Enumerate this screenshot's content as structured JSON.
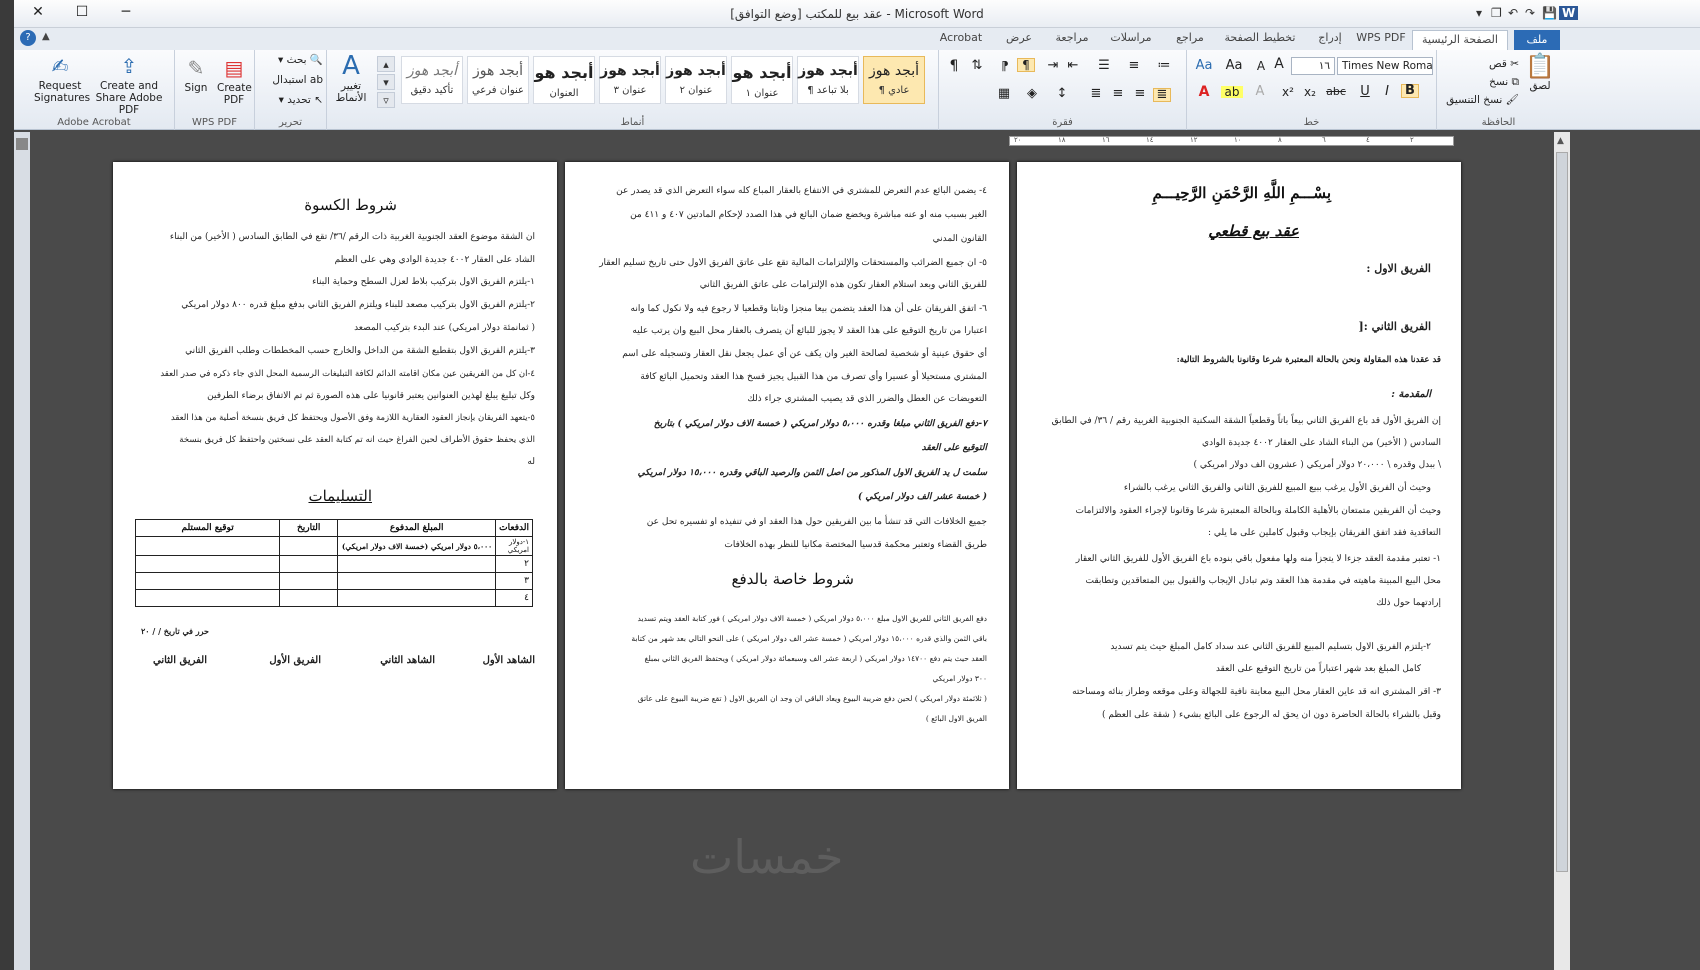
{
  "window": {
    "title": "عقد بيع للمكتب [وضع التوافق] - Microsoft Word",
    "close": "✕",
    "maximize": "☐",
    "minimize": "─",
    "qat": [
      "▾",
      "❐",
      "↶",
      "↷",
      "💾",
      "W"
    ]
  },
  "tabs": [
    {
      "label": "ملف",
      "kind": "file"
    },
    {
      "label": "الصفحة الرئيسية",
      "kind": "selected"
    },
    {
      "label": "WPS PDF",
      "kind": "normal"
    },
    {
      "label": "إدراج",
      "kind": "normal"
    },
    {
      "label": "تخطيط الصفحة",
      "kind": "normal"
    },
    {
      "label": "مراجع",
      "kind": "normal"
    },
    {
      "label": "مراسلات",
      "kind": "normal"
    },
    {
      "label": "مراجعة",
      "kind": "normal"
    },
    {
      "label": "عرض",
      "kind": "normal"
    },
    {
      "label": "Acrobat",
      "kind": "normal"
    }
  ],
  "ribbon": {
    "acrobat": {
      "group": "Adobe Acrobat",
      "request": "Request Signatures",
      "create_share": "Create and Share Adobe PDF"
    },
    "wps": {
      "group": "WPS PDF",
      "sign": "Sign",
      "create": "Create PDF"
    },
    "editing": {
      "group": "تحرير",
      "find": "بحث",
      "replace": "استبدال",
      "select": "تحديد"
    },
    "change_styles": "تغيير الأنماط",
    "styles": {
      "group": "أنماط",
      "items": [
        {
          "preview": "أبجد هوز",
          "label": "¶ عادي"
        },
        {
          "preview": "أبجد هوز",
          "label": "¶ بلا تباعد"
        },
        {
          "preview": "أبجد هو",
          "label": "عنوان ١"
        },
        {
          "preview": "أبجد هوز",
          "label": "عنوان ٢"
        },
        {
          "preview": "أبجد هوز",
          "label": "عنوان ٣"
        },
        {
          "preview": "أبجد هو",
          "label": "العنوان"
        },
        {
          "preview": "أبجد هوز",
          "label": "عنوان فرعي"
        },
        {
          "preview": "أبجد هوز",
          "label": "تأكيد دقيق"
        }
      ]
    },
    "paragraph": {
      "group": "فقرة"
    },
    "font": {
      "group": "خط",
      "name": "Times New Roma",
      "size": "١٦"
    },
    "clipboard": {
      "group": "الحافظة",
      "paste": "لصق",
      "cut": "قص",
      "copy": "نسخ",
      "format_painter": "نسخ التنسيق"
    }
  },
  "ruler": {
    "ticks": [
      "٢٠",
      "١٨",
      "١٦",
      "١٤",
      "١٢",
      "١٠",
      "٨",
      "٦",
      "٤",
      "٢"
    ]
  },
  "page1": {
    "bismillah": "بِسْـــمِ اللَّهِ الرَّحْمَنِ الرَّحِيـــمِ",
    "title": "عقد بيع قطعي",
    "party1": "الفريق الاول :",
    "party2": "الفريق الثاني :[",
    "intro": "قد عقدنا هذه المقاولة ونحن بالحالة المعتبرة شرعا وقانونا بالشروط التالية:",
    "preamble_title": "المقدمة :",
    "lines": [
      "إن الفريق الأول قد باع الفريق الثاني بيعاً باتاً وقطعياً الشقة السكنية الجنوبية الغربية رقم / ٣٦/ في الطابق",
      "السادس ( الأخير) من البناء الشاد على العقار ٤٠٠٢ جديدة الوادي",
      "\\ ببدل وقدره \\ ٢٠،٠٠٠ دولار أمريكي ( عشرون الف دولار امريكي )",
      "وحيث أن الفريق الأول يرغب ببيع المبيع  للفريق الثاني والفريق الثاني يرغب بالشراء",
      "وحيث أن الفريقين متمتعان بالأهلية الكاملة وبالحالة المعتبرة شرعا وقانونا لإجراء العقود والالتزامات",
      "التعاقدية فقد اتفق الفريقان بإيجاب وقبول كاملين على ما يلي :",
      "١-   تعتبر مقدمة العقد جزءا لا يتجزأ منه ولها مفعول باقي بنوده باع الفريق الأول للفريق الثاني العقار",
      "محل البيع المبينة ماهيته في مقدمة هذا العقد وتم تبادل الإيجاب والقبول بين المتعاقدين وتطابقت",
      "إرادتهما حول ذلك",
      "٢-يلتزم الفريق الاول  بتسليم المبيع للفريق الثاني عند سداد كامل المبلغ حيث يتم تسديد",
      "كامل المبلغ بعد شهر اعتباراً من تاريخ التوقيع على العقد",
      "٣- اقر المشتري انه قد عاين العقار محل البيع معاينة نافية للجهالة وعلى موقعه وطراز بنائه ومساحته",
      "وقبل بالشراء بالحالة الحاضرة دون ان يحق له الرجوع على البائع بشيء ( شقة على العظم )"
    ]
  },
  "page2": {
    "lines": [
      "٤- يضمن البائع عدم التعرض للمشتري في الانتفاع بالعقار المباع كله سواء التعرض الذي قد يصدر عن",
      "الغير بسبب منه او عنه مباشرة ويخضع ضمان البائع في هذا الصدد لإحكام المادتين ٤٠٧ و ٤١١ من",
      "القانون المدني",
      "٥- ان جميع الضرائب والمستحقات والإلتزامات المالية تقع على عاتق الفريق الاول حتى تاريخ تسليم العقار",
      "للفريق الثاني وبعد استلام العقار تكون هذه الإلتزامات على عاتق الفريق الثاني",
      "٦- اتفق الفريقان على أن هذا العقد يتضمن بيعا منجزا وثابتا وقطعيا لا رجوع فيه ولا نكول كما وانه",
      "اعتبارا من تاريخ التوقيع على هذا العقد لا يجوز للبائع أن يتصرف بالعقار محل البيع وان يرتب عليه",
      "أي حقوق عينية أو شخصية لصالحة الغير وان يكف عن أي عمل يجعل نقل العقار وتسجيله على اسم",
      "المشتري مستحيلا أو عسيرا وأي تصرف من هذا القبيل يجيز فسخ هذا العقد وتحميل البائع كافة",
      "التعويضات عن العطل والضرر الذي قد يصيب المشتري جراء ذلك",
      "٧-دفع الفريق الثاني مبلغا وقدره ٥،٠٠٠ دولار امريكي ( خمسة الاف دولار امريكي ) بتاريخ",
      "التوقيع على العقد",
      "سلمت ل يد الفريق الاول المذكور من اصل الثمن والرصيد الباقي وقدره ١٥،٠٠٠ دولار امريكي",
      "( خمسة عشر الف دولار امريكي )",
      "جميع الخلافات التي قد تنشأ ما بين الفريقين حول هذا العقد او في تنفيذه او تفسيره تحل عن",
      "طريق القضاء وتعتبر محكمة قدسيا المختصة مكانيا للنظر بهذه الخلافات"
    ],
    "pay_title": "شروط خاصة بالدفع",
    "pay_lines": [
      "دفع الفريق الثاني للفريق الاول مبلغ ٥،٠٠٠ دولار امريكي ( خمسة الاف دولار امريكي ) فور كتابة العقد ويتم تسديد",
      "باقي الثمن والذي قدره ١٥،٠٠٠ دولار امريكي ( خمسة عشر الف دولار امريكي ) على النحو التالي بعد شهر من كتابة",
      "العقد حيث يتم دفع ١٤٧٠٠ دولار امريكي ( اربعة عشر الف وسبعمائة دولار امريكي )  ويحتفظ الفريق الثاني بمبلغ",
      "٣٠٠ دولار امريكي",
      "( ثلاثمئة دولار امريكي ) لحين دفع ضريبة البيوع ويعاد الباقي ان وجد ان الفريق الاول ( تقع ضريبة البيوع على عاتق",
      "الفريق الاول البائع )"
    ]
  },
  "page3": {
    "title": "شروط الكسوة",
    "lines": [
      "ان الشقة موضوع العقد الجنوبية الغربية ذات الرقم /٣٦/  تقع في الطابق السادس ( الأخير) من البناء",
      "الشاد على العقار ٤٠٠٢ جديدة الوادي وهي على العظم",
      "١-يلتزم الفريق الاول بتركيب بلاط لعزل السطح وحماية البناء",
      "٢-يلتزم الفريق الاول بتركيب مصعد للبناء ويلتزم الفريق الثاني بدفع مبلغ قدره ٨٠٠ دولار امريكي",
      "( ثمانمئة دولار امريكي) عند البدء بتركيب المصعد",
      "٣-يلتزم الفريق الاول بتقطيع الشقة من الداخل والخارج حسب المخططات وطلب الفريق الثاني",
      "٤-ان كل من الفريقين عين مكان اقامته الدائم لكافة التبليغات الرسمية المحل الذي جاء ذكره في صدر العقد",
      "وكل تبليغ  يبلغ لهذين العنوانين يعتبر قانونيا على هذه الصورة ثم تم الاتفاق برضاء الطرفين",
      "٥-يتعهد الفريقان بإنجاز العقود العقارية اللازمة وفق الأصول ويحتفظ كل فريق بنسخة أصلية من هذا العقد",
      "الذي يحفظ حقوق الأطراف لحين الفراغ حيث انه تم كتابة العقد على نسختين واحتفظ كل فريق بنسخة",
      "له"
    ],
    "receipts_title": "التسليمات",
    "table": {
      "headers": [
        "الدفعات",
        "المبلغ المدفوع",
        "التاريخ",
        "توقيع المستلم"
      ],
      "rows": [
        [
          "١-دولار امريكي",
          "٥،٠٠٠ دولار امريكي (خمسة الاف دولار امريكي)",
          "",
          ""
        ],
        [
          "٢",
          "",
          "",
          ""
        ],
        [
          "٣",
          "",
          "",
          ""
        ],
        [
          "٤",
          "",
          "",
          ""
        ]
      ]
    },
    "dated": "حرر في تاريخ   /   /   ٢٠",
    "signatories": [
      "الشاهد الأول",
      "الشاهد الثاني",
      "الفريق الأول",
      "الفريق الثاني"
    ]
  },
  "watermark": "خمسات"
}
